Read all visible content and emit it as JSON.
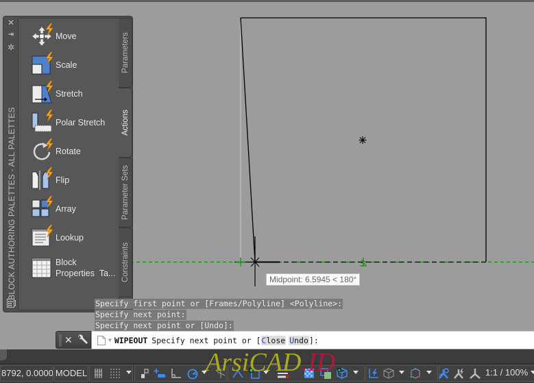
{
  "palette": {
    "title": "BLOCK AUTHORING PALETTES - ALL PALETTES",
    "controls": [
      "close-icon",
      "auto-hide-icon",
      "properties-icon"
    ],
    "tools": [
      {
        "label": "Move",
        "icon": "move-action-icon"
      },
      {
        "label": "Scale",
        "icon": "scale-action-icon"
      },
      {
        "label": "Stretch",
        "icon": "stretch-action-icon"
      },
      {
        "label": "Polar Stretch",
        "icon": "polar-stretch-action-icon"
      },
      {
        "label": "Rotate",
        "icon": "rotate-action-icon"
      },
      {
        "label": "Flip",
        "icon": "flip-action-icon"
      },
      {
        "label": "Array",
        "icon": "array-action-icon"
      },
      {
        "label": "Lookup",
        "icon": "lookup-action-icon"
      },
      {
        "label": "Block",
        "label2": "Properties  Ta...",
        "icon": "block-properties-table-icon"
      }
    ],
    "tabs": [
      {
        "label": "Parameters",
        "active": false
      },
      {
        "label": "Actions",
        "active": true
      },
      {
        "label": "Parameter Sets",
        "active": false
      },
      {
        "label": "Constraints",
        "active": false
      }
    ]
  },
  "canvas": {
    "tooltip": "Midpoint: 6.5945 < 180°",
    "colors": {
      "background": "#9c9c9c",
      "geometry": "#000000",
      "tracking": "#1a8a1a"
    }
  },
  "command": {
    "history": [
      "Specify first point or [Frames/Polyline] <Polyline>:",
      "Specify next point:",
      "Specify next point or [Undo]:"
    ],
    "current_command": "WIPEOUT",
    "prompt_text": "Specify next point or [",
    "options": [
      {
        "key": "C",
        "rest": "lose"
      },
      {
        "key": "U",
        "rest": "ndo"
      }
    ],
    "prompt_end": "]:"
  },
  "statusbar": {
    "coordinates": "8792, 0.0000",
    "space": "MODEL",
    "scale": "1:1 / 100%",
    "toggles": [
      {
        "name": "grid-display",
        "active": false
      },
      {
        "name": "snap-mode",
        "active": false
      },
      {
        "name": "infer-constraints",
        "active": false
      },
      {
        "name": "dynamic-input",
        "active": true
      },
      {
        "name": "ortho-mode",
        "active": false
      },
      {
        "name": "polar-tracking",
        "active": true
      },
      {
        "name": "isometric-drafting",
        "active": false
      },
      {
        "name": "object-snap-tracking",
        "active": true
      },
      {
        "name": "object-snap",
        "active": true
      },
      {
        "name": "lineweight",
        "active": false
      },
      {
        "name": "transparency",
        "active": true
      },
      {
        "name": "selection-cycling",
        "active": false
      },
      {
        "name": "3d-object-snap",
        "active": true
      },
      {
        "name": "dynamic-ucs",
        "active": true
      },
      {
        "name": "selection-filtering",
        "active": false
      },
      {
        "name": "gizmo",
        "active": false
      },
      {
        "name": "annotation-visibility",
        "active": true
      },
      {
        "name": "auto-scale",
        "active": false
      },
      {
        "name": "annotation-scale",
        "active": false
      }
    ]
  },
  "watermark": {
    "part1": "ArsiCAD",
    "part2": ".ID"
  }
}
